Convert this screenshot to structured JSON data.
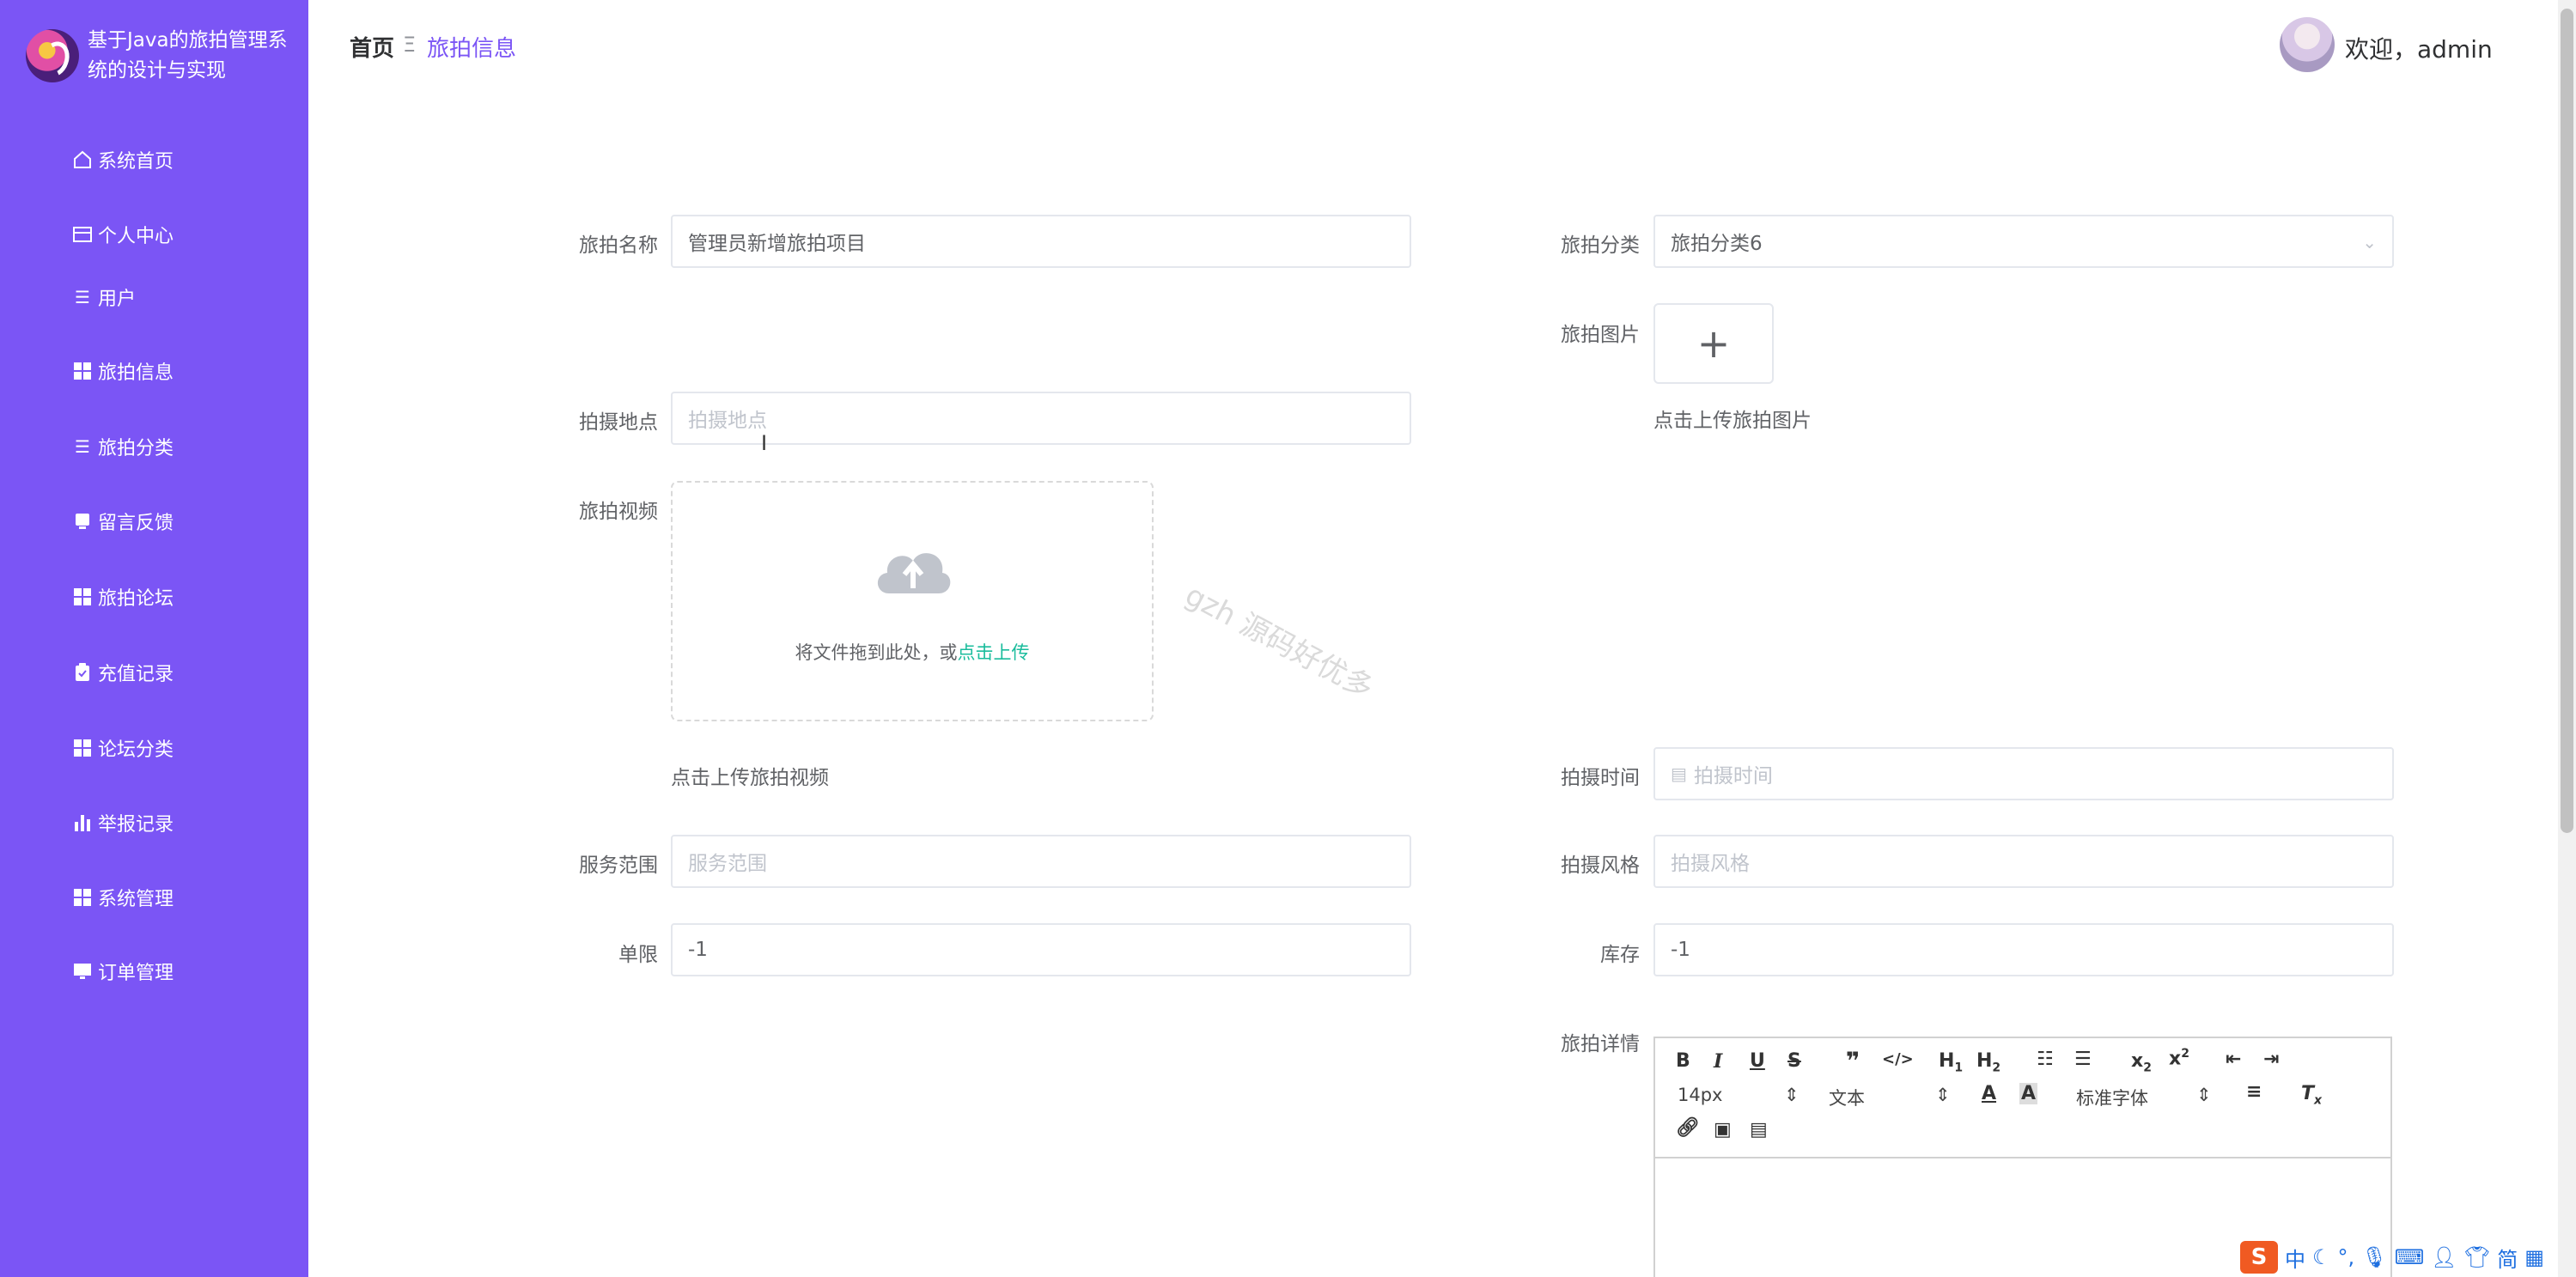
{
  "sidebar": {
    "title": "基于Java的旅拍管理系统的设计与实现",
    "items": [
      {
        "label": "系统首页",
        "icon": "home-icon"
      },
      {
        "label": "个人中心",
        "icon": "card-icon"
      },
      {
        "label": "用户",
        "icon": "list-icon"
      },
      {
        "label": "旅拍信息",
        "icon": "grid-icon"
      },
      {
        "label": "旅拍分类",
        "icon": "list-icon"
      },
      {
        "label": "留言反馈",
        "icon": "message-icon"
      },
      {
        "label": "旅拍论坛",
        "icon": "grid-icon"
      },
      {
        "label": "充值记录",
        "icon": "clipboard-icon"
      },
      {
        "label": "论坛分类",
        "icon": "grid-icon"
      },
      {
        "label": "举报记录",
        "icon": "bar-chart-icon"
      },
      {
        "label": "系统管理",
        "icon": "grid-icon"
      },
      {
        "label": "订单管理",
        "icon": "monitor-icon"
      }
    ]
  },
  "header": {
    "breadcrumb_home": "首页",
    "breadcrumb_sep": "Ξ",
    "breadcrumb_current": "旅拍信息",
    "welcome": "欢迎，admin"
  },
  "form": {
    "name_label": "旅拍名称",
    "name_value": "管理员新增旅拍项目",
    "category_label": "旅拍分类",
    "category_value": "旅拍分类6",
    "image_label": "旅拍图片",
    "image_tip": "点击上传旅拍图片",
    "location_label": "拍摄地点",
    "location_placeholder": "拍摄地点",
    "video_label": "旅拍视频",
    "video_drop_text": "将文件拖到此处，或",
    "video_drop_link": "点击上传",
    "video_tip": "点击上传旅拍视频",
    "time_label": "拍摄时间",
    "time_placeholder": "拍摄时间",
    "scope_label": "服务范围",
    "scope_placeholder": "服务范围",
    "style_label": "拍摄风格",
    "style_placeholder": "拍摄风格",
    "limit_label": "单限",
    "limit_value": "-1",
    "stock_label": "库存",
    "stock_value": "-1",
    "detail_label": "旅拍详情"
  },
  "editor": {
    "font_size": "14px",
    "block_type": "文本",
    "font_family": "标准字体"
  },
  "watermark": "gzh 源码好优多",
  "ime": {
    "lang": "中",
    "simplified": "简"
  }
}
